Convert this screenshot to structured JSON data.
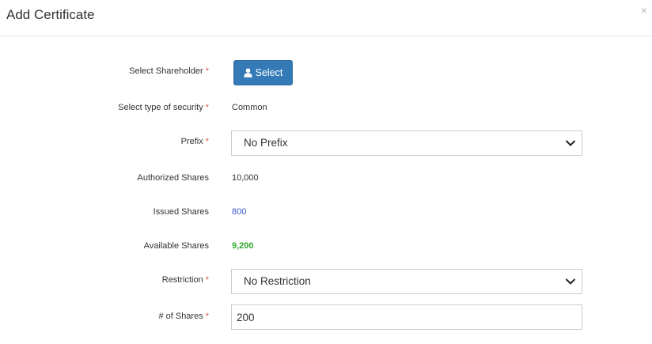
{
  "modal": {
    "title": "Add Certificate",
    "close_icon": "close-icon",
    "close_glyph": "×"
  },
  "form": {
    "required_marker": "*",
    "shareholder": {
      "label": "Select Shareholder",
      "button_label": "Select",
      "button_icon": "user-icon"
    },
    "security_type": {
      "label": "Select type of security",
      "value": "Common"
    },
    "prefix": {
      "label": "Prefix",
      "selected": "No Prefix"
    },
    "authorized_shares": {
      "label": "Authorized Shares",
      "value": "10,000"
    },
    "issued_shares": {
      "label": "Issued Shares",
      "value": "800",
      "color": "#3a56c9"
    },
    "available_shares": {
      "label": "Available Shares",
      "value": "9,200",
      "color": "#2eaa2e"
    },
    "restriction": {
      "label": "Restriction",
      "selected": "No Restriction"
    },
    "num_shares": {
      "label": "# of Shares",
      "value": "200"
    }
  },
  "colors": {
    "primary_button": "#337ab7",
    "required": "#d9534f"
  }
}
